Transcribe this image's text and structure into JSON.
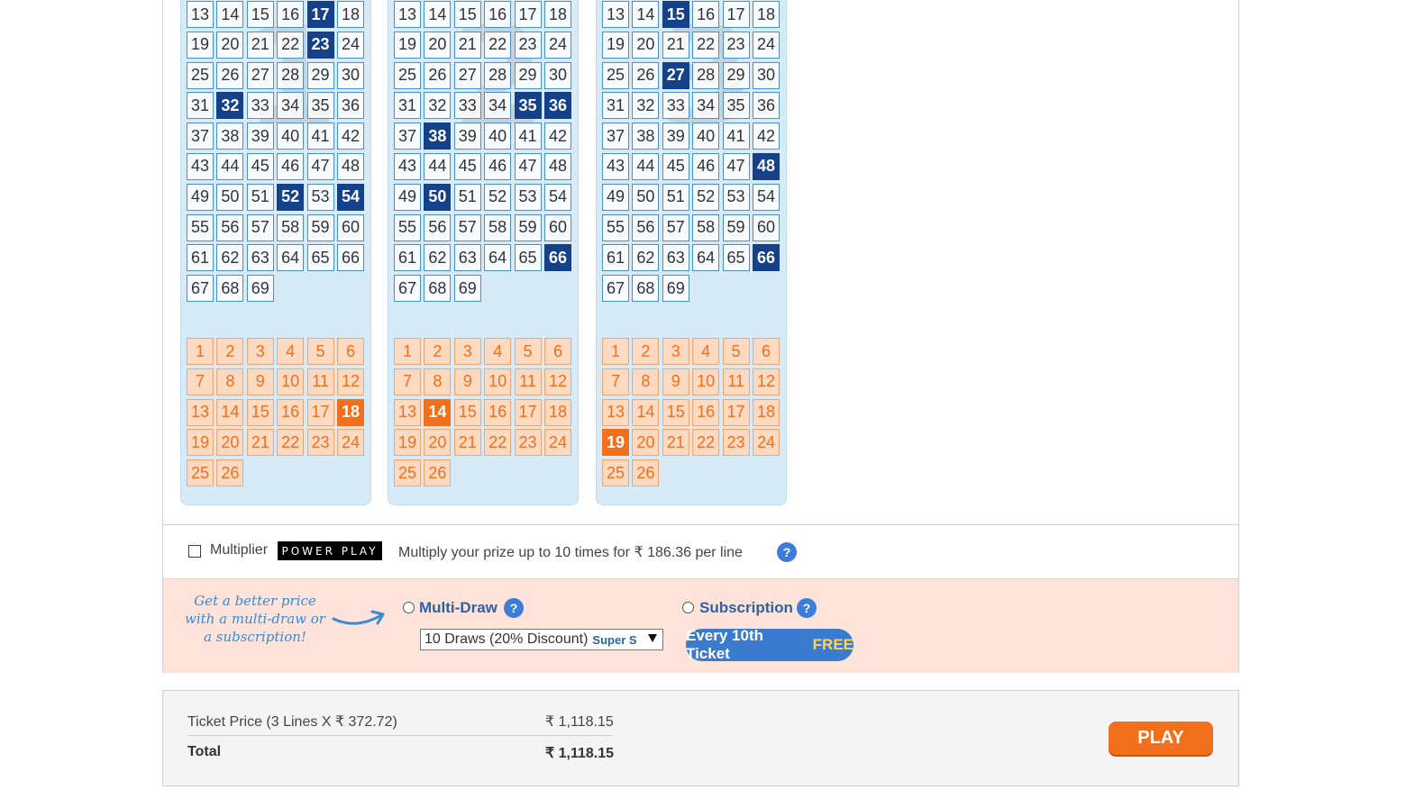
{
  "tickets": [
    {
      "number": "1",
      "main_numbers": [
        "13",
        "14",
        "15",
        "16",
        "17",
        "18",
        "19",
        "20",
        "21",
        "22",
        "23",
        "24",
        "25",
        "26",
        "27",
        "28",
        "29",
        "30",
        "31",
        "32",
        "33",
        "34",
        "35",
        "36",
        "37",
        "38",
        "39",
        "40",
        "41",
        "42",
        "43",
        "44",
        "45",
        "46",
        "47",
        "48",
        "49",
        "50",
        "51",
        "52",
        "53",
        "54",
        "55",
        "56",
        "57",
        "58",
        "59",
        "60",
        "61",
        "62",
        "63",
        "64",
        "65",
        "66",
        "67",
        "68",
        "69"
      ],
      "main_selected": [
        "17",
        "23",
        "32",
        "52",
        "54"
      ],
      "powerball_numbers": [
        "1",
        "2",
        "3",
        "4",
        "5",
        "6",
        "7",
        "8",
        "9",
        "10",
        "11",
        "12",
        "13",
        "14",
        "15",
        "16",
        "17",
        "18",
        "19",
        "20",
        "21",
        "22",
        "23",
        "24",
        "25",
        "26"
      ],
      "powerball_selected": [
        "18"
      ]
    },
    {
      "number": "2",
      "main_numbers": [
        "13",
        "14",
        "15",
        "16",
        "17",
        "18",
        "19",
        "20",
        "21",
        "22",
        "23",
        "24",
        "25",
        "26",
        "27",
        "28",
        "29",
        "30",
        "31",
        "32",
        "33",
        "34",
        "35",
        "36",
        "37",
        "38",
        "39",
        "40",
        "41",
        "42",
        "43",
        "44",
        "45",
        "46",
        "47",
        "48",
        "49",
        "50",
        "51",
        "52",
        "53",
        "54",
        "55",
        "56",
        "57",
        "58",
        "59",
        "60",
        "61",
        "62",
        "63",
        "64",
        "65",
        "66",
        "67",
        "68",
        "69"
      ],
      "main_selected": [
        "35",
        "36",
        "38",
        "50",
        "66"
      ],
      "powerball_numbers": [
        "1",
        "2",
        "3",
        "4",
        "5",
        "6",
        "7",
        "8",
        "9",
        "10",
        "11",
        "12",
        "13",
        "14",
        "15",
        "16",
        "17",
        "18",
        "19",
        "20",
        "21",
        "22",
        "23",
        "24",
        "25",
        "26"
      ],
      "powerball_selected": [
        "14"
      ]
    },
    {
      "number": "3",
      "main_numbers": [
        "13",
        "14",
        "15",
        "16",
        "17",
        "18",
        "19",
        "20",
        "21",
        "22",
        "23",
        "24",
        "25",
        "26",
        "27",
        "28",
        "29",
        "30",
        "31",
        "32",
        "33",
        "34",
        "35",
        "36",
        "37",
        "38",
        "39",
        "40",
        "41",
        "42",
        "43",
        "44",
        "45",
        "46",
        "47",
        "48",
        "49",
        "50",
        "51",
        "52",
        "53",
        "54",
        "55",
        "56",
        "57",
        "58",
        "59",
        "60",
        "61",
        "62",
        "63",
        "64",
        "65",
        "66",
        "67",
        "68",
        "69"
      ],
      "main_selected": [
        "15",
        "27",
        "48",
        "66"
      ],
      "powerball_numbers": [
        "1",
        "2",
        "3",
        "4",
        "5",
        "6",
        "7",
        "8",
        "9",
        "10",
        "11",
        "12",
        "13",
        "14",
        "15",
        "16",
        "17",
        "18",
        "19",
        "20",
        "21",
        "22",
        "23",
        "24",
        "25",
        "26"
      ],
      "powerball_selected": [
        "19"
      ]
    }
  ],
  "multiplier": {
    "label": "Multiplier",
    "logo_text": "POWER PLAY",
    "description": "Multiply your prize up to 10 times for ₹ 186.36 per line",
    "help": "?",
    "checked": false
  },
  "multidraw": {
    "promo": "Get a better price with a multi-draw or a subscription!",
    "label": "Multi-Draw",
    "help": "?",
    "select_value": "10 Draws (20% Discount)",
    "select_extra": "Super S",
    "subscription_label": "Subscription",
    "subscription_help": "?",
    "badge_text": "Every 10th Ticket",
    "badge_free": "FREE"
  },
  "summary": {
    "ticket_price_label": "Ticket Price (3 Lines X ₹ 372.72)",
    "ticket_price_value": "₹ 1,118.15",
    "total_label": "Total",
    "total_value": "₹ 1,118.15",
    "play_label": "PLAY"
  },
  "colors": {
    "selected_main": "#15418a",
    "selected_powerball": "#f26f1b",
    "panel_bg": "#d7eaf8",
    "promo_bg": "#fde3d9"
  }
}
